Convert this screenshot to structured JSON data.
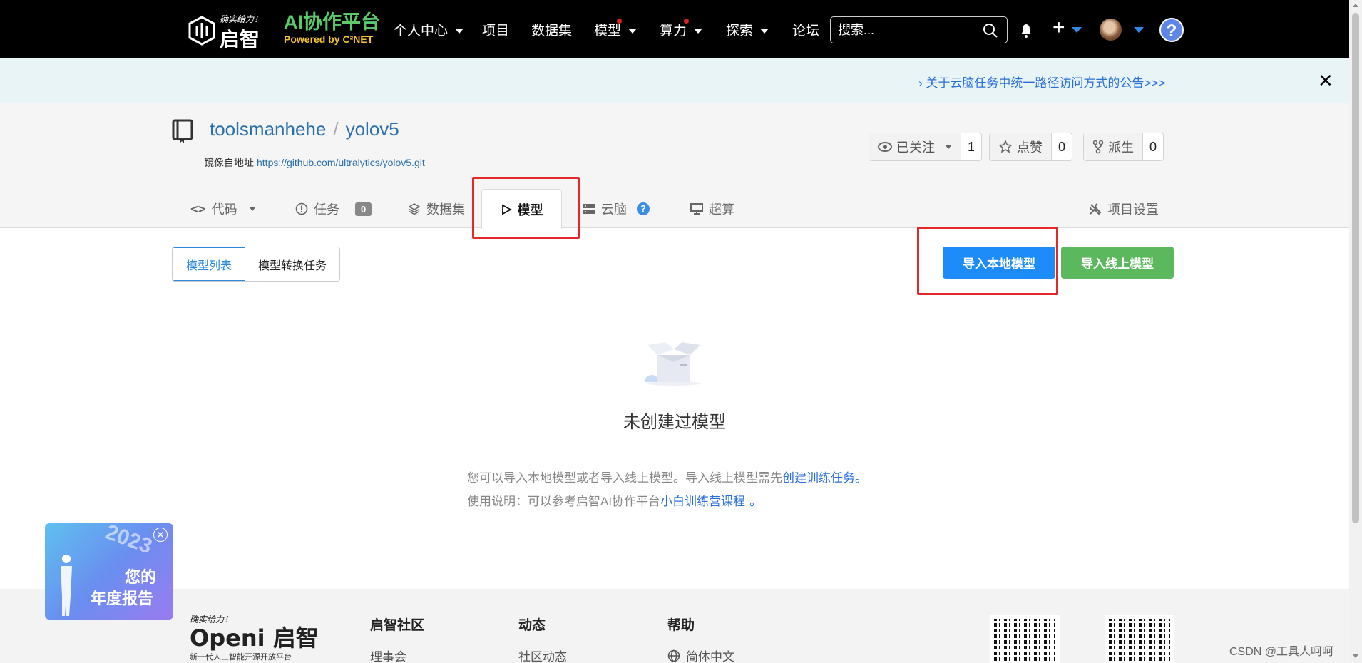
{
  "nav": {
    "logo_slogan": "确实给力！",
    "logo_name": "启智",
    "brand_title": "AI协作平台",
    "brand_sub": "Powered by C²NET",
    "items": [
      {
        "label": "个人中心"
      },
      {
        "label": "项目"
      },
      {
        "label": "数据集"
      },
      {
        "label": "模型"
      },
      {
        "label": "算力"
      },
      {
        "label": "探索"
      },
      {
        "label": "论坛"
      }
    ],
    "search_placeholder": "搜索...",
    "help": "?",
    "plus": "+"
  },
  "announcement": {
    "text": "› 关于云脑任务中统一路径访问方式的公告>>>",
    "close": "✕"
  },
  "repo": {
    "owner": "toolsmanhehe",
    "separator": "/",
    "name": "yolov5",
    "mirror_label": "镜像自地址",
    "mirror_url": "https://github.com/ultralytics/yolov5.git",
    "watch": {
      "label": "已关注",
      "count": "1"
    },
    "star": {
      "label": "点赞",
      "count": "0"
    },
    "fork": {
      "label": "派生",
      "count": "0"
    },
    "tabs": {
      "code": "代码",
      "issues": "任务",
      "issues_count": "0",
      "datasets": "数据集",
      "models": "模型",
      "cloudbrain": "云脑",
      "cloudbrain_badge": "?",
      "supercompute": "超算",
      "settings": "项目设置"
    }
  },
  "content": {
    "seg_model_list": "模型列表",
    "seg_convert_tasks": "模型转换任务",
    "import_local": "导入本地模型",
    "import_online": "导入线上模型",
    "empty_title": "未创建过模型",
    "hint1_pre": "您可以导入本地模型或者导入线上模型。导入线上模型需先",
    "hint1_link": "创建训练任务",
    "hint1_post": "。",
    "hint2_pre": "使用说明：可以参考启智AI协作平台",
    "hint2_link": "小白训练营课程",
    "hint2_post": "。"
  },
  "footer": {
    "logo_slogan": "确实给力！",
    "logo_name": "Openi 启智",
    "logo_sub": "新一代人工智能开源开放平台",
    "col1_title": "启智社区",
    "col1_item": "理事会",
    "col2_title": "动态",
    "col2_item": "社区动态",
    "col3_title": "帮助",
    "col3_item": "简体中文"
  },
  "report_popup": {
    "year": "2023",
    "line1": "您的",
    "line2": "年度报告",
    "close": "✕"
  },
  "watermark": "CSDN @工具人呵呵",
  "colors": {
    "nav_bg": "#000000",
    "brand_green": "#5bc96a",
    "brand_yellow": "#f4c430",
    "primary_blue": "#1d8cf8",
    "success_green": "#5cb85c",
    "highlight_red": "#e5262a"
  }
}
